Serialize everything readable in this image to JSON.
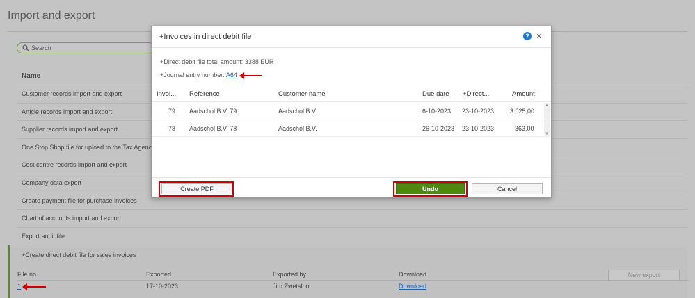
{
  "page": {
    "title": "Import and export",
    "search_placeholder": "Search",
    "name_header": "Name",
    "list_items": [
      "Customer records import and export",
      "Article records import and export",
      "Supplier records import and export",
      "One Stop Shop file for upload to the Tax Agency",
      "Cost centre records import and export",
      "Company data export",
      "Create payment file for purchase invoices",
      "Chart of accounts import and export",
      "Export audit file"
    ],
    "expanded": {
      "title": "+Create direct debit file for sales invoices",
      "columns": [
        "File no",
        "Exported",
        "Exported by",
        "Download"
      ],
      "row": {
        "file_no": "1",
        "exported": "17-10-2023",
        "exported_by": "Jim Zwetsloot",
        "download": "Download"
      },
      "new_export_label": "New export"
    }
  },
  "modal": {
    "title": "+Invoices in direct debit file",
    "total_amount_text": "+Direct debit file total amount: 3388 EUR",
    "journal_label": "+Journal entry number: ",
    "journal_link": "A64",
    "columns": [
      "Invoi...",
      "Reference",
      "Customer name",
      "Due date",
      "+Direct...",
      "Amount"
    ],
    "rows": [
      {
        "invoice": "79",
        "reference": "Aadschol B.V. 79",
        "customer": "Aadschol B.V.",
        "due": "6-10-2023",
        "direct": "23-10-2023",
        "amount": "3.025,00"
      },
      {
        "invoice": "78",
        "reference": "Aadschol B.V. 78",
        "customer": "Aadschol B.V.",
        "due": "26-10-2023",
        "direct": "23-10-2023",
        "amount": "363,00"
      }
    ],
    "create_pdf_label": "Create PDF",
    "undo_label": "Undo",
    "cancel_label": "Cancel",
    "help_icon": "?",
    "close_icon": "×"
  },
  "colors": {
    "accent_green": "#4f8a10",
    "highlight_red": "#d40000",
    "link_blue": "#1f5fa8",
    "help_blue": "#1e7bd0"
  }
}
